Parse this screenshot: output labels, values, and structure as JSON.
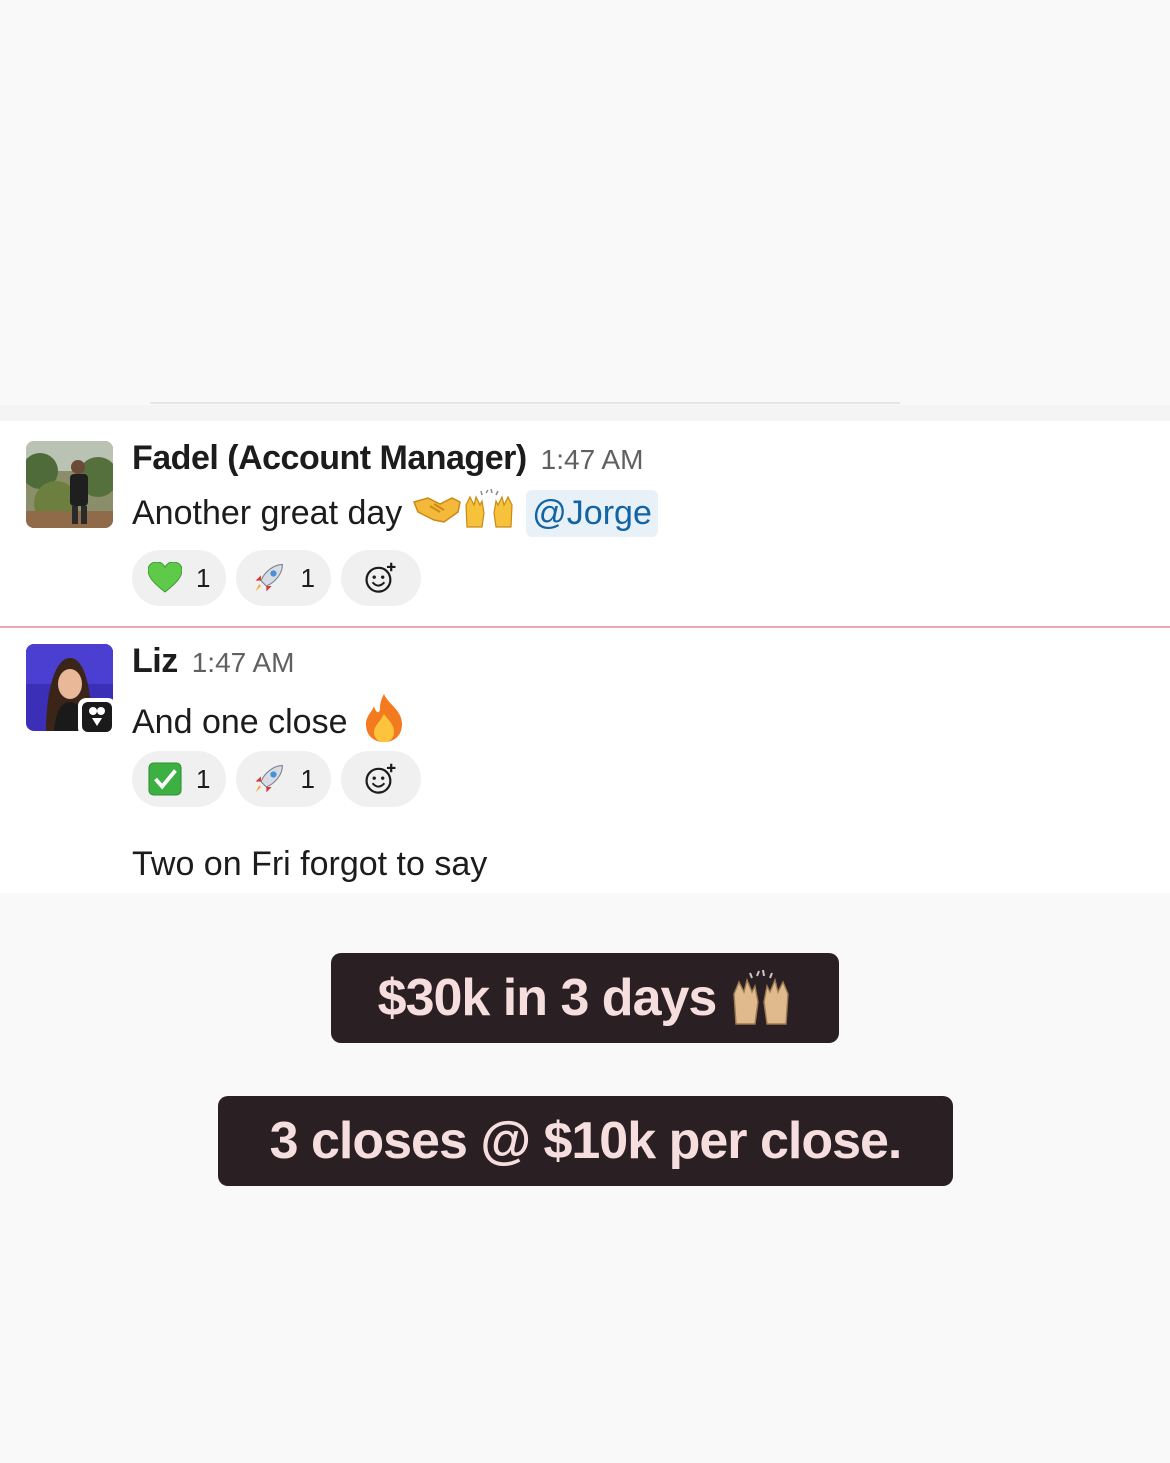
{
  "messages": [
    {
      "sender": "Fadel (Account Manager)",
      "time": "1:47 AM",
      "text": "Another great day",
      "emojis": [
        "handshake-emoji",
        "raising-hands-emoji"
      ],
      "mention": "@Jorge",
      "reactions": [
        {
          "icon": "green-heart-emoji",
          "count": "1"
        },
        {
          "icon": "rocket-emoji",
          "count": "1"
        }
      ]
    },
    {
      "sender": "Liz",
      "time": "1:47 AM",
      "text": "And one close",
      "emojis": [
        "fire-emoji"
      ],
      "reactions": [
        {
          "icon": "check-mark-emoji",
          "count": "1"
        },
        {
          "icon": "rocket-emoji",
          "count": "1"
        }
      ],
      "followup": "Two on Fri forgot to say"
    }
  ],
  "captions": {
    "first": "$30k in 3 days",
    "second": "3 closes @ $10k per close."
  },
  "colors": {
    "mention_bg": "#e8f1f8",
    "mention_text": "#1264a3",
    "new_divider": "#e8a8b4",
    "caption_bg": "#2a1f22",
    "caption_text": "#f6dede"
  }
}
